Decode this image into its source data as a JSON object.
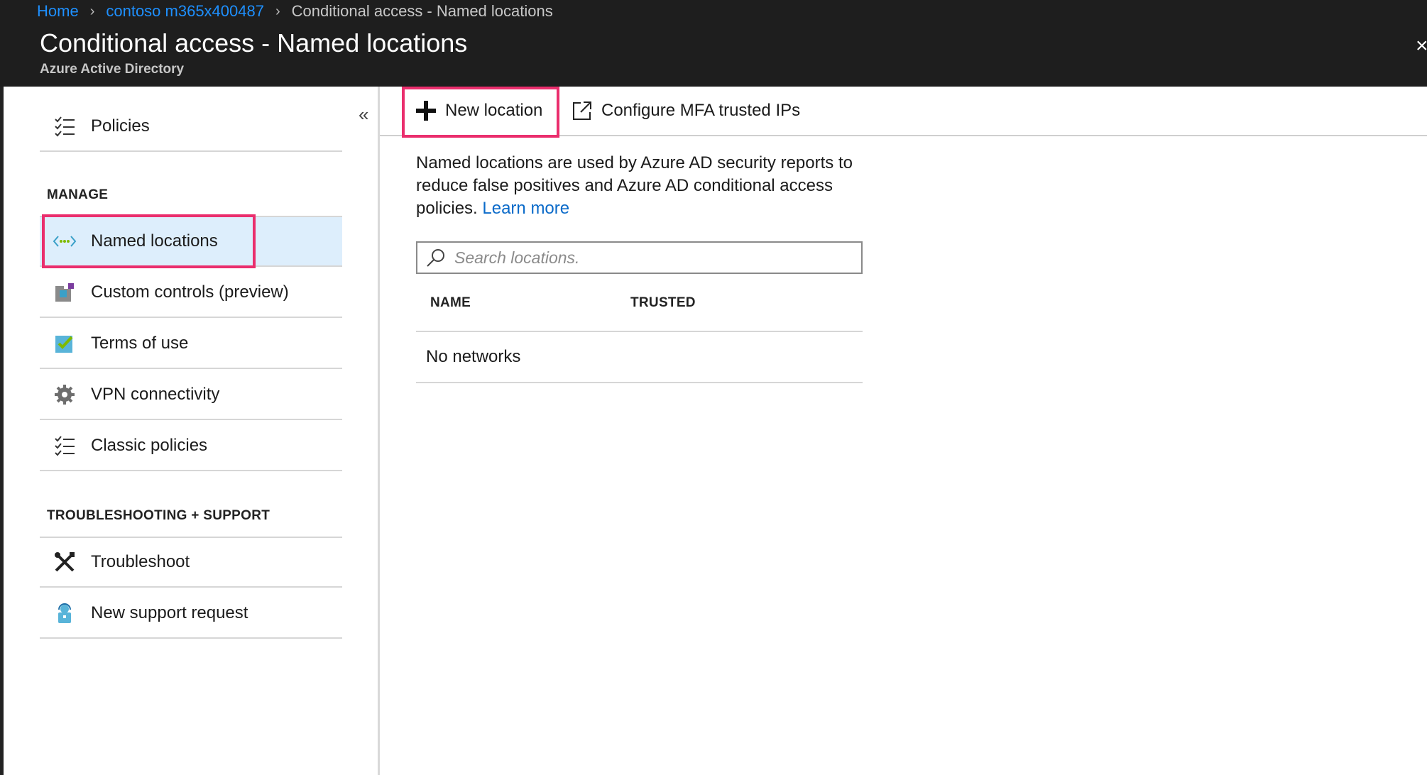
{
  "breadcrumb": {
    "items": [
      {
        "label": "Home",
        "link": true
      },
      {
        "label": "contoso m365x400487",
        "link": true
      },
      {
        "label": "Conditional access - Named locations",
        "link": false
      }
    ]
  },
  "header": {
    "title": "Conditional access - Named locations",
    "subtitle": "Azure Active Directory"
  },
  "sidebar": {
    "collapse_glyph": "«",
    "top_items": [
      {
        "label": "Policies",
        "icon": "checklist-icon"
      }
    ],
    "manage_heading": "MANAGE",
    "manage_items": [
      {
        "label": "Named locations",
        "icon": "named-locations-icon",
        "active": true
      },
      {
        "label": "Custom controls (preview)",
        "icon": "custom-controls-icon"
      },
      {
        "label": "Terms of use",
        "icon": "terms-of-use-icon"
      },
      {
        "label": "VPN connectivity",
        "icon": "gear-icon"
      },
      {
        "label": "Classic policies",
        "icon": "checklist-icon"
      }
    ],
    "support_heading": "TROUBLESHOOTING + SUPPORT",
    "support_items": [
      {
        "label": "Troubleshoot",
        "icon": "tools-icon"
      },
      {
        "label": "New support request",
        "icon": "support-person-icon"
      }
    ]
  },
  "toolbar": {
    "new_location_label": "New location",
    "configure_mfa_label": "Configure MFA trusted IPs"
  },
  "main": {
    "description": "Named locations are used by Azure AD security reports to reduce false positives and Azure AD conditional access policies.",
    "learn_more": "Learn more",
    "search_placeholder": "Search locations.",
    "table": {
      "columns": [
        "NAME",
        "TRUSTED"
      ],
      "empty_text": "No networks"
    }
  },
  "colors": {
    "accent": "#0a6ac9",
    "highlight": "#ea2e6d",
    "topbar": "#1e1e1e",
    "active_item": "#ddeefc"
  }
}
